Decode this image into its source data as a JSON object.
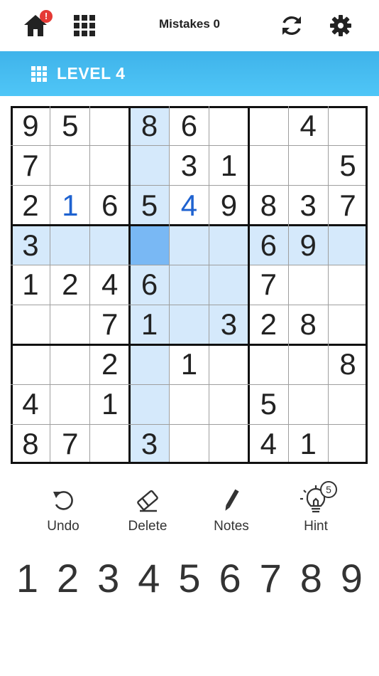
{
  "header": {
    "home_badge": "!",
    "mistakes": "Mistakes 0"
  },
  "banner": {
    "level": "LEVEL 4"
  },
  "board": {
    "cells": [
      [
        "9",
        "5",
        "",
        "8",
        "6",
        "",
        "",
        "4",
        ""
      ],
      [
        "7",
        "",
        "",
        "",
        "3",
        "1",
        "",
        "",
        "5"
      ],
      [
        "2",
        "1",
        "6",
        "5",
        "4",
        "9",
        "8",
        "3",
        "7"
      ],
      [
        "3",
        "",
        "",
        "",
        "",
        "",
        "6",
        "9",
        ""
      ],
      [
        "1",
        "2",
        "4",
        "6",
        "",
        "",
        "7",
        "",
        ""
      ],
      [
        "",
        "",
        "7",
        "1",
        "",
        "3",
        "2",
        "8",
        ""
      ],
      [
        "",
        "",
        "2",
        "",
        "1",
        "",
        "",
        "",
        "8"
      ],
      [
        "4",
        "",
        "1",
        "",
        "",
        "",
        "5",
        "",
        ""
      ],
      [
        "8",
        "7",
        "",
        "3",
        "",
        "",
        "4",
        "1",
        ""
      ]
    ],
    "user_entered": [
      [
        2,
        1
      ],
      [
        2,
        4
      ]
    ],
    "selected": [
      3,
      3
    ],
    "colors": {
      "highlight": "#d5e9fb",
      "selected": "#79b8f4",
      "user_digit": "#1e62d0"
    }
  },
  "tools": {
    "undo": "Undo",
    "delete": "Delete",
    "notes": "Notes",
    "hint": "Hint",
    "hint_count": "5"
  },
  "numpad": [
    "1",
    "2",
    "3",
    "4",
    "5",
    "6",
    "7",
    "8",
    "9"
  ],
  "colors": {
    "banner": "#4fc6f7",
    "badge": "#e53935"
  },
  "icons": [
    "home-icon",
    "grid-icon",
    "refresh-icon",
    "gear-icon",
    "undo-icon",
    "eraser-icon",
    "pencil-icon",
    "lightbulb-icon"
  ]
}
